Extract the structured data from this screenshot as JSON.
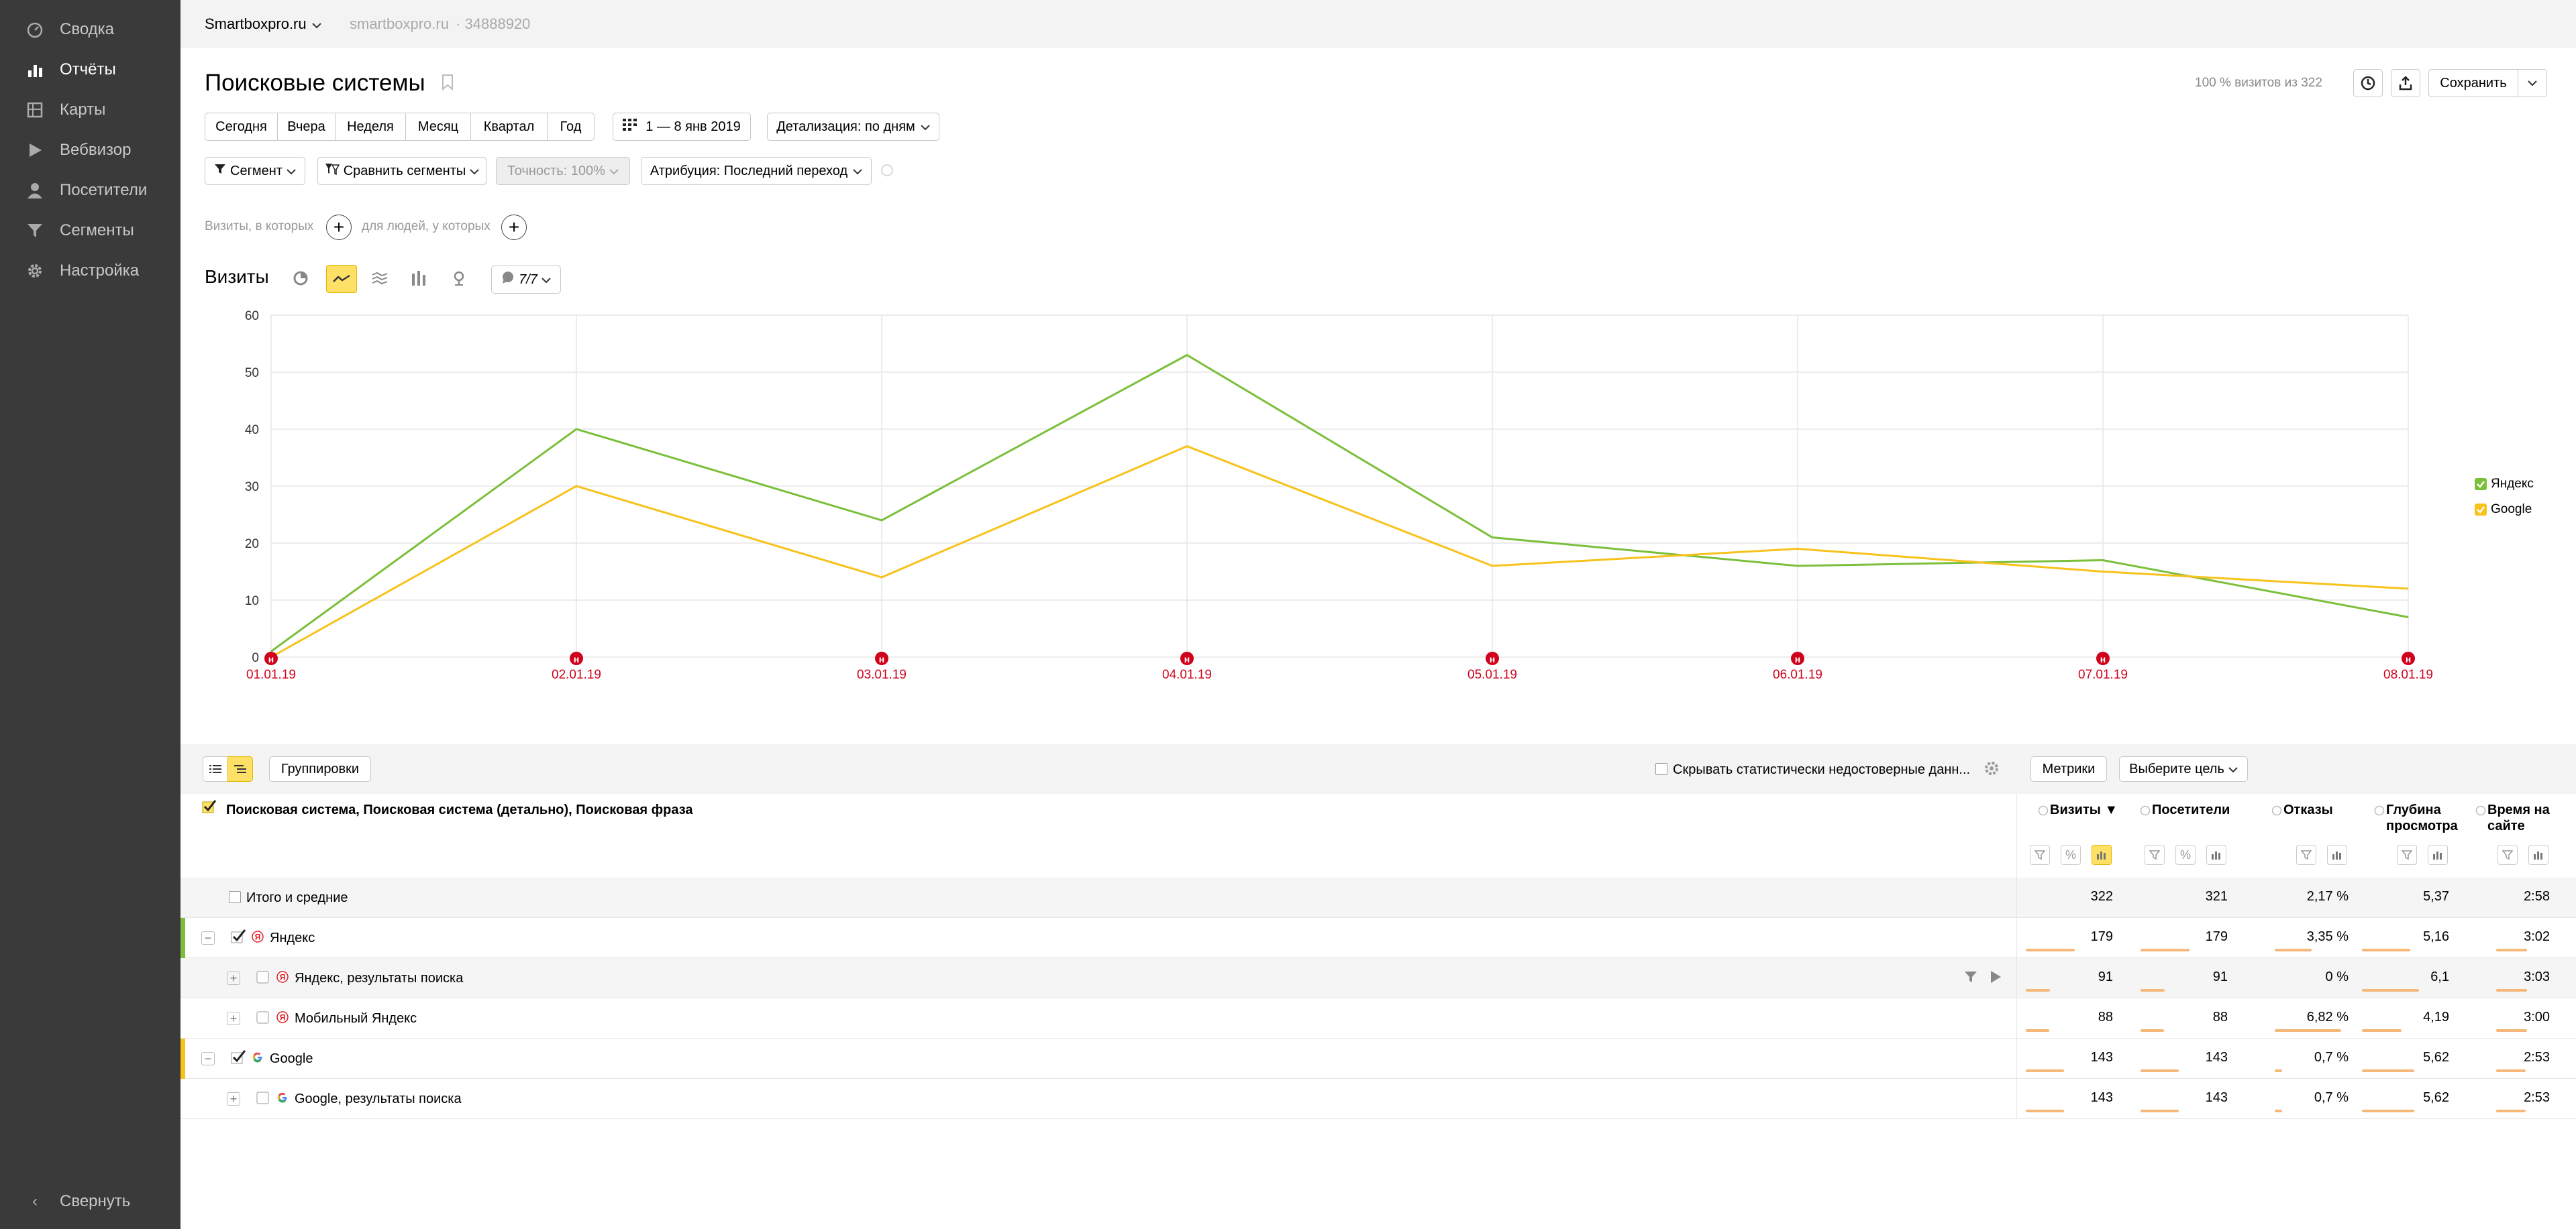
{
  "sidebar": {
    "items": [
      {
        "label": "Сводка",
        "icon": "gauge-icon",
        "active": false
      },
      {
        "label": "Отчёты",
        "icon": "bar-chart-icon",
        "active": true
      },
      {
        "label": "Карты",
        "icon": "map-icon",
        "active": false
      },
      {
        "label": "Вебвизор",
        "icon": "play-icon",
        "active": false
      },
      {
        "label": "Посетители",
        "icon": "person-icon",
        "active": false
      },
      {
        "label": "Сегменты",
        "icon": "filter-icon",
        "active": false
      },
      {
        "label": "Настройка",
        "icon": "gear-icon",
        "active": false
      }
    ],
    "collapse_label": "Свернуть"
  },
  "topbar": {
    "site_name": "Smartboxpro.ru",
    "site_domain": "smartboxpro.ru",
    "counter_id": "· 34888920"
  },
  "header": {
    "title": "Поисковые системы",
    "visits_info": "100 % визитов из 322",
    "save_label": "Сохранить"
  },
  "period": {
    "buttons": [
      "Сегодня",
      "Вчера",
      "Неделя",
      "Месяц",
      "Квартал",
      "Год"
    ],
    "date_range": "1 — 8 янв 2019",
    "detail": "Детализация: по дням"
  },
  "filters": {
    "segment": "Сегмент",
    "compare": "Сравнить сегменты",
    "accuracy": "Точность: 100%",
    "attribution": "Атрибуция: Последний переход"
  },
  "segment_builder": {
    "visits_label": "Визиты, в которых",
    "people_label": "для людей, у которых"
  },
  "chart_header": {
    "title": "Визиты",
    "series_count": "7/7"
  },
  "chart_data": {
    "type": "line",
    "categories": [
      "01.01.19",
      "02.01.19",
      "03.01.19",
      "04.01.19",
      "05.01.19",
      "06.01.19",
      "07.01.19",
      "08.01.19"
    ],
    "ylim": [
      0,
      60
    ],
    "yticks": [
      0,
      10,
      20,
      30,
      40,
      50,
      60
    ],
    "holiday_marker": "н",
    "series": [
      {
        "name": "Яндекс",
        "color": "#7bbf3a",
        "values": [
          1,
          40,
          24,
          53,
          21,
          16,
          17,
          7
        ]
      },
      {
        "name": "Google",
        "color": "#f7c21b",
        "values": [
          0,
          30,
          14,
          37,
          16,
          19,
          15,
          12
        ]
      }
    ],
    "grid": true,
    "legend_position": "right"
  },
  "table_toolbar": {
    "groupings_label": "Группировки",
    "hide_unreliable_label": "Скрывать статистически недостоверные данн...",
    "metrics_label": "Метрики",
    "goal_label": "Выберите цель"
  },
  "table": {
    "dimension_header": "Поисковая система, Поисковая система (детально), Поисковая фраза",
    "columns": [
      {
        "label": "Визиты",
        "sorted": "▼"
      },
      {
        "label": "Посетители"
      },
      {
        "label": "Отказы"
      },
      {
        "label": "Глубина просмотра"
      },
      {
        "label": "Время на сайте"
      }
    ],
    "totals": {
      "label": "Итого и средние",
      "values": [
        "322",
        "321",
        "2,17 %",
        "5,37",
        "2:58"
      ]
    },
    "rows": [
      {
        "label": "Яндекс",
        "level": 0,
        "expander": "−",
        "checked": true,
        "stripe": "#7bbf3a",
        "values": [
          "179",
          "179",
          "3,35 %",
          "5,16",
          "3:02"
        ],
        "fill": [
          0.56,
          0.56,
          0.5,
          0.55,
          0.58
        ]
      },
      {
        "label": "Яндекс, результаты поиска",
        "level": 1,
        "expander": "+",
        "checked": false,
        "highlight": true,
        "values": [
          "91",
          "91",
          "0 %",
          "6,1",
          "3:03"
        ],
        "fill": [
          0.28,
          0.28,
          0.0,
          0.65,
          0.58
        ]
      },
      {
        "label": "Мобильный Яндекс",
        "level": 1,
        "expander": "+",
        "checked": false,
        "values": [
          "88",
          "88",
          "6,82 %",
          "4,19",
          "3:00"
        ],
        "fill": [
          0.27,
          0.27,
          0.9,
          0.45,
          0.57
        ]
      },
      {
        "label": "Google",
        "level": 0,
        "expander": "−",
        "checked": true,
        "stripe": "#f7c21b",
        "values": [
          "143",
          "143",
          "0,7 %",
          "5,62",
          "2:53"
        ],
        "fill": [
          0.44,
          0.44,
          0.1,
          0.6,
          0.55
        ]
      },
      {
        "label": "Google, результаты поиска",
        "level": 1,
        "expander": "+",
        "checked": false,
        "values": [
          "143",
          "143",
          "0,7 %",
          "5,62",
          "2:53"
        ],
        "fill": [
          0.44,
          0.44,
          0.1,
          0.6,
          0.55
        ]
      }
    ]
  }
}
